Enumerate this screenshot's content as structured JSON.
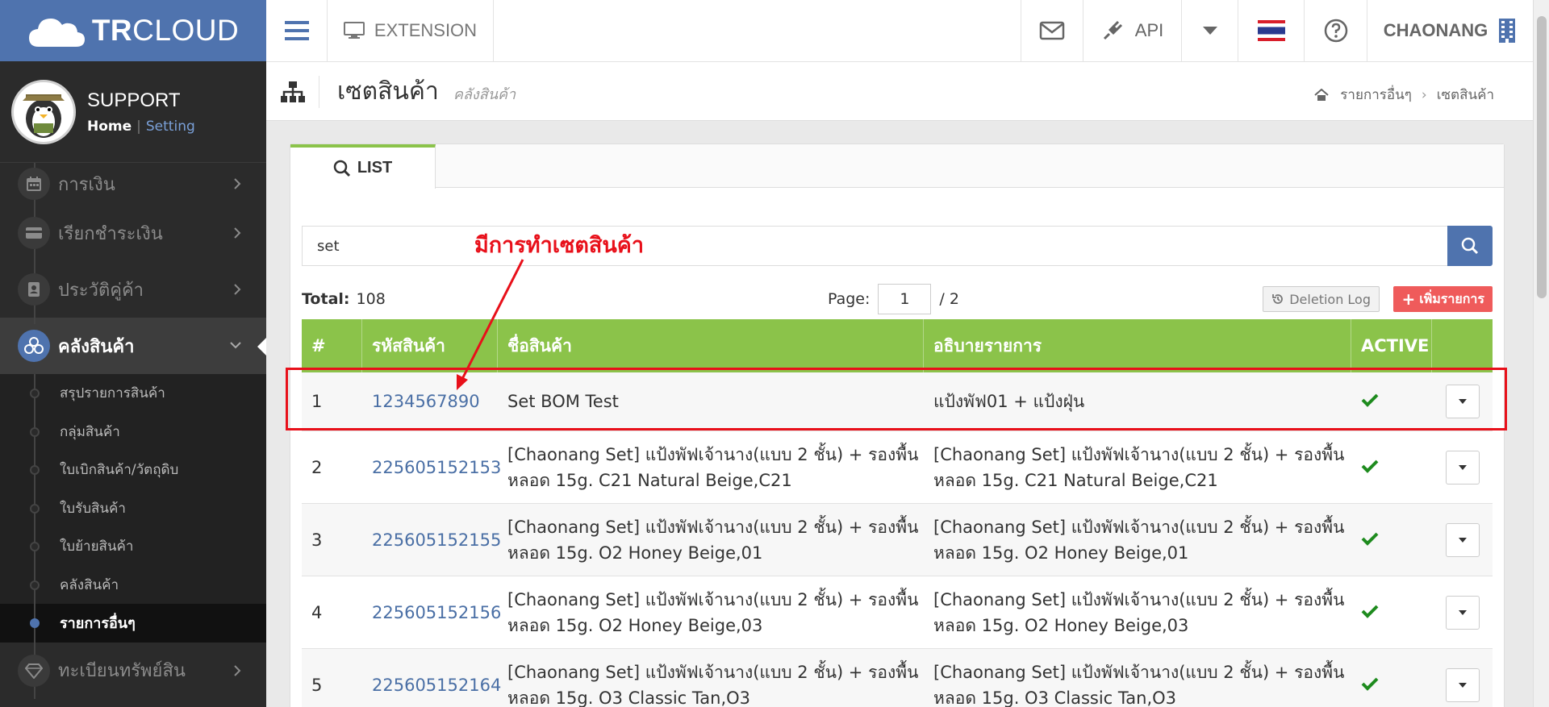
{
  "brand": {
    "bold": "TR",
    "normal": "CLOUD"
  },
  "profile": {
    "name": "SUPPORT",
    "home": "Home",
    "separator": "|",
    "setting": "Setting"
  },
  "sidebar": {
    "items_top": [
      {
        "label": "การเงิน",
        "icon": "calendar-icon"
      },
      {
        "label": "เรียกชำระเงิน",
        "icon": "credit-card-icon"
      },
      {
        "label": "ประวัติคู่ค้า",
        "icon": "contact-book-icon"
      }
    ],
    "active": {
      "label": "คลังสินค้า",
      "icon": "cubes-icon"
    },
    "subitems": [
      "สรุปรายการสินค้า",
      "กลุ่มสินค้า",
      "ใบเบิกสินค้า/วัตถุดิบ",
      "ใบรับสินค้า",
      "ใบย้ายสินค้า",
      "คลังสินค้า",
      "รายการอื่นๆ"
    ],
    "bottom": {
      "label": "ทะเบียนทรัพย์สิน",
      "icon": "diamond-icon"
    }
  },
  "topbar": {
    "extension": "EXTENSION",
    "api": "API",
    "user": "CHAONANG"
  },
  "page": {
    "title": "เซตสินค้า",
    "subtitle": "คลังสินค้า",
    "breadcrumb": [
      "รายการอื่นๆ",
      "เซตสินค้า"
    ]
  },
  "tabs": {
    "list": "LIST"
  },
  "search": {
    "value": "set"
  },
  "info": {
    "total_label": "Total:",
    "total": "108",
    "page_label": "Page:",
    "page": "1",
    "page_total": "/ 2",
    "deletion_log": "Deletion Log",
    "add": "เพิ่มรายการ"
  },
  "table": {
    "headers": [
      "#",
      "รหัสสินค้า",
      "ชื่อสินค้า",
      "อธิบายรายการ",
      "ACTIVE"
    ],
    "rows": [
      {
        "num": "1",
        "code": "1234567890",
        "name": "Set BOM Test",
        "desc": "แป้งพัฟ01 + แป้งฝุ่น"
      },
      {
        "num": "2",
        "code": "225605152153",
        "name": "[Chaonang Set] แป้งพัฟเจ้านาง(แบบ 2 ชั้น) + รองพื้นหลอด 15g. C21 Natural Beige,C21",
        "desc": "[Chaonang Set] แป้งพัฟเจ้านาง(แบบ 2 ชั้น) + รองพื้นหลอด 15g. C21 Natural Beige,C21"
      },
      {
        "num": "3",
        "code": "225605152155",
        "name": "[Chaonang Set] แป้งพัฟเจ้านาง(แบบ 2 ชั้น) + รองพื้นหลอด 15g. O2 Honey Beige,01",
        "desc": "[Chaonang Set] แป้งพัฟเจ้านาง(แบบ 2 ชั้น) + รองพื้นหลอด 15g. O2 Honey Beige,01"
      },
      {
        "num": "4",
        "code": "225605152156",
        "name": "[Chaonang Set] แป้งพัฟเจ้านาง(แบบ 2 ชั้น) + รองพื้นหลอด 15g. O2 Honey Beige,03",
        "desc": "[Chaonang Set] แป้งพัฟเจ้านาง(แบบ 2 ชั้น) + รองพื้นหลอด 15g. O2 Honey Beige,03"
      },
      {
        "num": "5",
        "code": "225605152164",
        "name": "[Chaonang Set] แป้งพัฟเจ้านาง(แบบ 2 ชั้น) + รองพื้นหลอด 15g. O3 Classic Tan,O3",
        "desc": "[Chaonang Set] แป้งพัฟเจ้านาง(แบบ 2 ชั้น) + รองพื้นหลอด 15g. O3 Classic Tan,O3"
      }
    ]
  },
  "annotation": {
    "text": "มีการทำเซตสินค้า"
  },
  "colors": {
    "brand": "#4f73ae",
    "green": "#8bc34a",
    "red": "#e8101a",
    "sidebar": "#2b2b2b"
  }
}
